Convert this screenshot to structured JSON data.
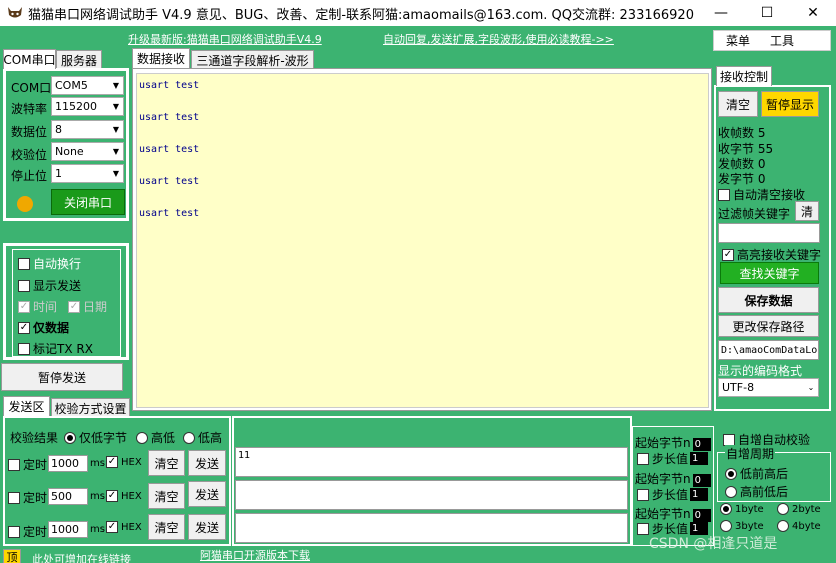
{
  "window": {
    "title": "猫猫串口网络调试助手 V4.9 意见、BUG、改善、定制-联系阿猫:amaomails@163.com. QQ交流群: 233166920",
    "minimize": "—",
    "maximize": "☐",
    "close": "✕"
  },
  "header": {
    "upgrade_link": "升级最新版:猫猫串口网络调试助手V4.9",
    "auto_reply_link": "自动回复,发送扩展,字段波形,使用必读教程->>",
    "menu_label": "菜单",
    "tools_label": "工具"
  },
  "left_tabs": {
    "com": "COM串口",
    "server": "服务器"
  },
  "serial": {
    "port_label": "COM口",
    "port_value": "COM5",
    "baud_label": "波特率",
    "baud_value": "115200",
    "databits_label": "数据位",
    "databits_value": "8",
    "parity_label": "校验位",
    "parity_value": "None",
    "stopbits_label": "停止位",
    "stopbits_value": "1",
    "close_port_button": "关闭串口",
    "status_color": "#f0a800"
  },
  "options": {
    "auto_newline": "自动换行",
    "show_send": "显示发送",
    "time": "时间",
    "date": "日期",
    "data_only": "仅数据",
    "mark_txrx": "标记TX RX",
    "pause_send_button": "暂停发送"
  },
  "main_tabs": {
    "receive": "数据接收",
    "waveform": "三通道字段解析-波形"
  },
  "receive_lines": [
    "usart test",
    "usart test",
    "usart test",
    "usart test",
    "usart test"
  ],
  "recv_control": {
    "tab": "接收控制",
    "clear_button": "清空",
    "pause_button": "暂停显示",
    "frames_label": "收帧数",
    "frames_value": "5",
    "bytes_label": "收字节",
    "bytes_value": "55",
    "sent_frames_label": "发帧数",
    "sent_frames_value": "0",
    "sent_bytes_label": "发字节",
    "sent_bytes_value": "0",
    "auto_clear": "自动清空接收",
    "filter_label": "过滤帧关键字",
    "filter_clear": "清",
    "highlight": "高亮接收关键字",
    "find_button": "查找关键字",
    "save_button": "保存数据",
    "change_path_button": "更改保存路径",
    "path_value": "D:\\amaoComDataLo",
    "encoding_label": "显示的编码格式",
    "encoding_value": "UTF-8"
  },
  "send_tabs": {
    "send": "发送区",
    "checksum": "校验方式设置"
  },
  "send_area": {
    "check_result_label": "校验结果",
    "only_low": "仅低字节",
    "high_low": "高低",
    "low_high": "低高",
    "rows": [
      {
        "timed_label": "定时",
        "interval": "1000",
        "unit": "ms",
        "hex_label": "HEX",
        "clear_label": "清空",
        "send_label": "发送",
        "text": "11"
      },
      {
        "timed_label": "定时",
        "interval": "500",
        "unit": "ms",
        "hex_label": "HEX",
        "clear_label": "清空",
        "send_label": "发送",
        "text": ""
      },
      {
        "timed_label": "定时",
        "interval": "1000",
        "unit": "ms",
        "hex_label": "HEX",
        "clear_label": "清空",
        "send_label": "发送",
        "text": ""
      }
    ]
  },
  "checksum_side": {
    "groups": [
      {
        "start_label": "起始字节n",
        "start_value": "0",
        "step_label": "步长值",
        "step_value": "1"
      },
      {
        "start_label": "起始字节n",
        "start_value": "0",
        "step_label": "步长值",
        "step_value": "1"
      },
      {
        "start_label": "起始字节n",
        "start_value": "0",
        "step_label": "步长值",
        "step_value": "1"
      }
    ],
    "auto_check": "自增自动校验",
    "period_label": "自增周期",
    "low_first": "低前高后",
    "high_first": "高前低后",
    "b1": "1byte",
    "b2": "2byte",
    "b3": "3byte",
    "b4": "4byte"
  },
  "footer": {
    "pin_label": "顶",
    "online_link": "此处可增加在线链接",
    "open_source_link": "阿猫串口开源版本下载",
    "watermark": "CSDN @相逢只道是"
  }
}
